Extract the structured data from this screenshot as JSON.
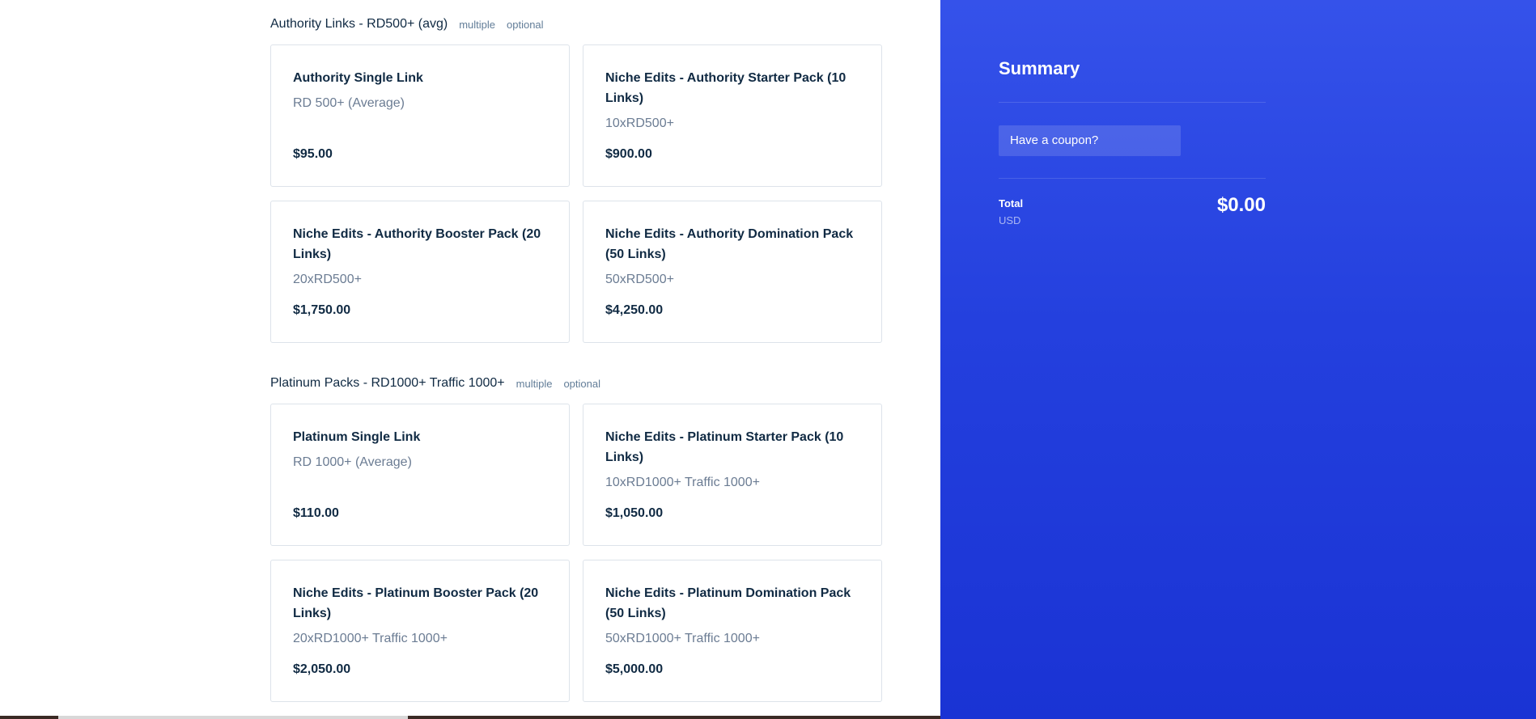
{
  "sections": [
    {
      "title": "Authority Links - RD500+ (avg)",
      "tags": [
        "multiple",
        "optional"
      ],
      "products": [
        {
          "name": "Authority Single Link",
          "desc": "RD 500+ (Average)",
          "price": "$95.00"
        },
        {
          "name": "Niche Edits - Authority Starter Pack (10 Links)",
          "desc": "10xRD500+",
          "price": "$900.00"
        },
        {
          "name": "Niche Edits - Authority Booster Pack (20 Links)",
          "desc": "20xRD500+",
          "price": "$1,750.00"
        },
        {
          "name": "Niche Edits - Authority Domination Pack (50 Links)",
          "desc": "50xRD500+",
          "price": "$4,250.00"
        }
      ]
    },
    {
      "title": "Platinum Packs - RD1000+ Traffic 1000+",
      "tags": [
        "multiple",
        "optional"
      ],
      "products": [
        {
          "name": "Platinum Single Link",
          "desc": "RD 1000+ (Average)",
          "price": "$110.00"
        },
        {
          "name": "Niche Edits - Platinum Starter Pack (10 Links)",
          "desc": "10xRD1000+ Traffic 1000+",
          "price": "$1,050.00"
        },
        {
          "name": "Niche Edits - Platinum Booster Pack (20 Links)",
          "desc": "20xRD1000+ Traffic 1000+",
          "price": "$2,050.00"
        },
        {
          "name": "Niche Edits - Platinum Domination Pack (50 Links)",
          "desc": "50xRD1000+ Traffic 1000+",
          "price": "$5,000.00"
        }
      ]
    }
  ],
  "summary": {
    "title": "Summary",
    "coupon_label": "Have a coupon?",
    "total_label": "Total",
    "currency": "USD",
    "total_amount": "$0.00"
  },
  "colors": {
    "accent": "#2440de",
    "text_dark": "#102a43",
    "text_muted": "#6b7c93"
  }
}
